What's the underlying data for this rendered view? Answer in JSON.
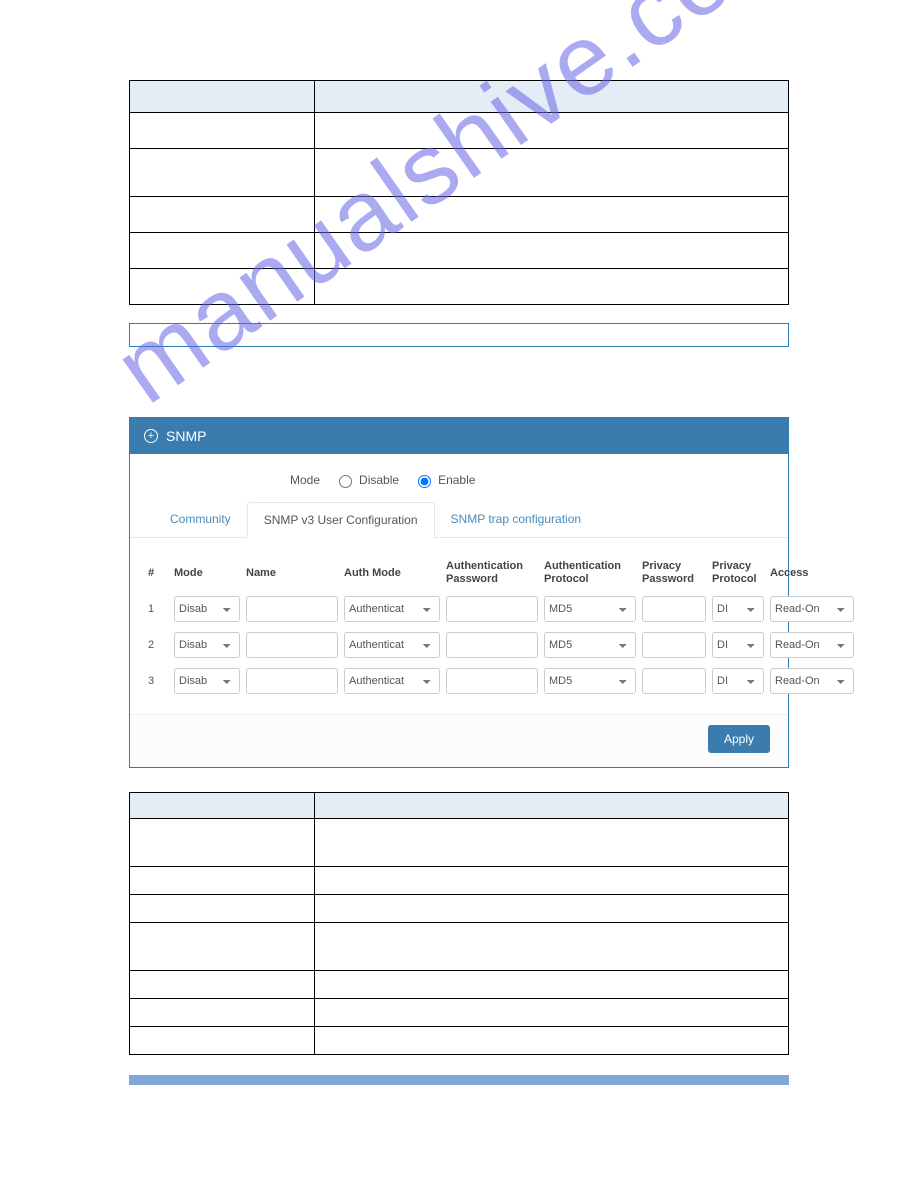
{
  "panel": {
    "title": "SNMP",
    "mode_label": "Mode",
    "disable_label": "Disable",
    "enable_label": "Enable",
    "mode_selected": "Enable"
  },
  "tabs": {
    "items": [
      {
        "label": "Community",
        "active": false
      },
      {
        "label": "SNMP v3 User Configuration",
        "active": true
      },
      {
        "label": "SNMP trap configuration",
        "active": false
      }
    ]
  },
  "columns": {
    "num": "#",
    "mode": "Mode",
    "name": "Name",
    "auth_mode": "Auth Mode",
    "auth_password": "Authentication Password",
    "auth_protocol": "Authentication Protocol",
    "priv_password": "Privacy Password",
    "priv_protocol": "Privacy Protocol",
    "access": "Access"
  },
  "rows": [
    {
      "num": "1",
      "mode": "Disab",
      "name": "",
      "auth_mode": "Authenticat",
      "auth_password": "",
      "auth_protocol": "MD5",
      "priv_password": "",
      "priv_protocol": "DI",
      "access": "Read-On"
    },
    {
      "num": "2",
      "mode": "Disab",
      "name": "",
      "auth_mode": "Authenticat",
      "auth_password": "",
      "auth_protocol": "MD5",
      "priv_password": "",
      "priv_protocol": "DI",
      "access": "Read-On"
    },
    {
      "num": "3",
      "mode": "Disab",
      "name": "",
      "auth_mode": "Authenticat",
      "auth_password": "",
      "auth_protocol": "MD5",
      "priv_password": "",
      "priv_protocol": "DI",
      "access": "Read-On"
    }
  ],
  "buttons": {
    "apply": "Apply"
  },
  "watermark": "manualshive.com"
}
